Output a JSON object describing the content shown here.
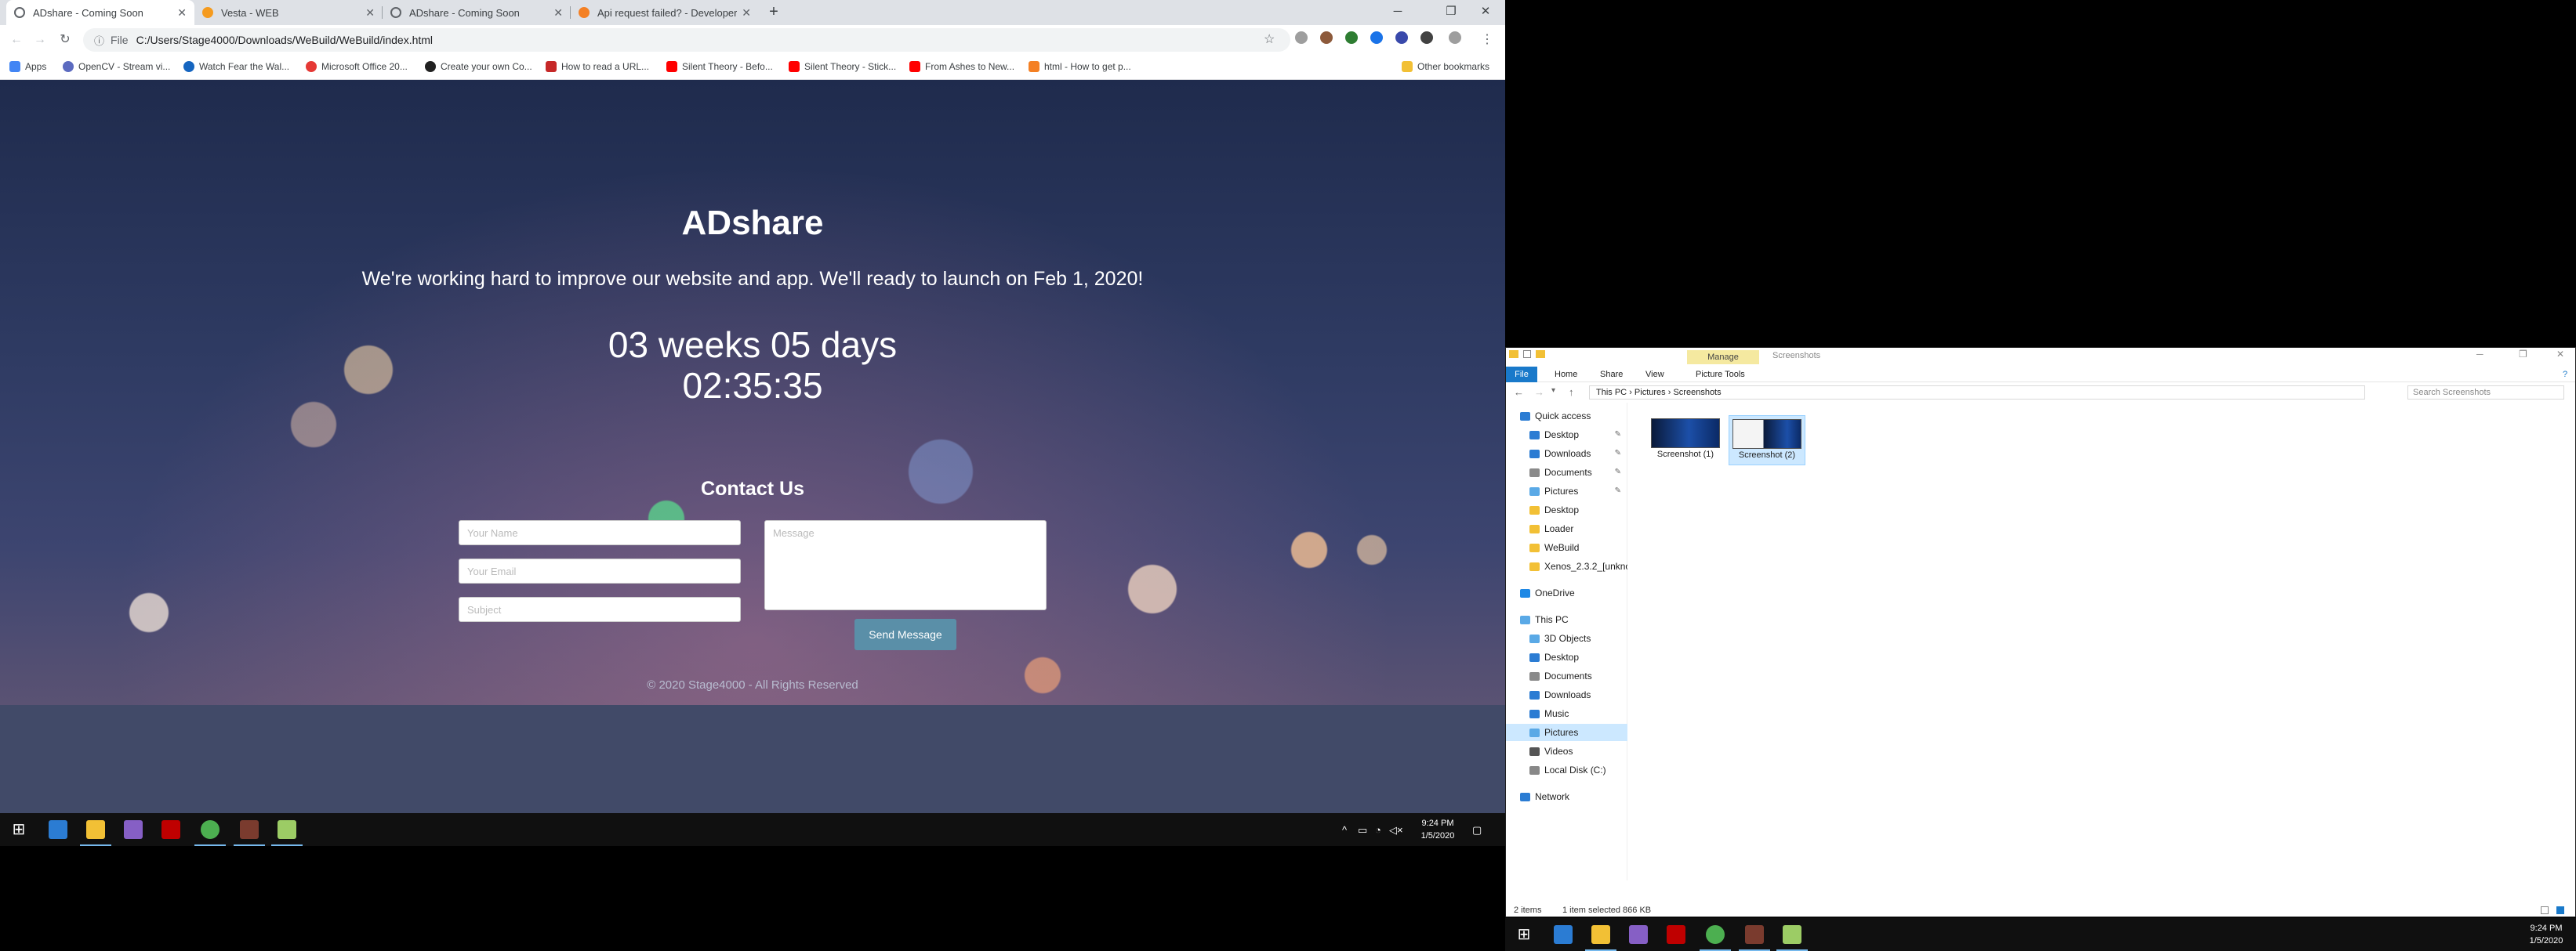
{
  "browser": {
    "tabs": [
      {
        "title": "ADshare - Coming Soon",
        "active": true,
        "favicon_color": "#5f6368"
      },
      {
        "title": "Vesta - WEB",
        "active": false,
        "favicon_color": "#f59b1f"
      },
      {
        "title": "ADshare - Coming Soon",
        "active": false,
        "favicon_color": "#5f6368"
      },
      {
        "title": "Api request failed? - Developers",
        "active": false,
        "favicon_color": "#f48024"
      }
    ],
    "new_tab": "+",
    "window_controls": [
      "─",
      "❐",
      "✕"
    ],
    "nav_glyphs": [
      "←",
      "→",
      "↻"
    ],
    "address_info": "ⓘ",
    "address_scheme": "File",
    "address_url": "C:/Users/Stage4000/Downloads/WeBuild/WeBuild/index.html",
    "star_glyph": "☆",
    "menu_glyph": "⋮",
    "bookmarks": [
      {
        "label": "Apps",
        "color": "#4285f4"
      },
      {
        "label": "OpenCV - Stream vi...",
        "color": "#5c6bc0"
      },
      {
        "label": "Watch Fear the Wal...",
        "color": "#1565c0"
      },
      {
        "label": "Microsoft Office 20...",
        "color": "#e53935"
      },
      {
        "label": "Create your own Co...",
        "color": "#212121"
      },
      {
        "label": "How to read a URL...",
        "color": "#c62828"
      },
      {
        "label": "Silent Theory - Befo...",
        "color": "#ff0000"
      },
      {
        "label": "Silent Theory - Stick...",
        "color": "#ff0000"
      },
      {
        "label": "From Ashes to New...",
        "color": "#ff0000"
      },
      {
        "label": "html - How to get p...",
        "color": "#f48024"
      }
    ],
    "other_bookmarks": "Other bookmarks"
  },
  "site": {
    "title": "ADshare",
    "tagline": "We're working hard to improve our website and app. We'll ready to launch on Feb 1, 2020!",
    "countdown_line1": "03 weeks 05 days",
    "countdown_line2": "02:35:35",
    "contact_heading": "Contact Us",
    "name_placeholder": "Your Name",
    "email_placeholder": "Your Email",
    "subject_placeholder": "Subject",
    "message_placeholder": "Message",
    "send_label": "Send Message",
    "copyright": "© 2020 Stage4000 - All Rights Reserved"
  },
  "taskbar": {
    "start_glyph": "⊞",
    "apps": [
      {
        "name": "edge",
        "color": "#2b7cd3",
        "running": false
      },
      {
        "name": "file-explorer",
        "color": "#f2c035",
        "running": true
      },
      {
        "name": "visual-studio",
        "color": "#865fc5",
        "running": false
      },
      {
        "name": "filezilla",
        "color": "#bf0000",
        "running": false
      },
      {
        "name": "chrome",
        "color": "#4caf50",
        "running": true
      },
      {
        "name": "winrar",
        "color": "#7a3b2e",
        "running": true
      },
      {
        "name": "notepad-plus",
        "color": "#9ccc65",
        "running": true
      }
    ],
    "tray_glyphs": [
      "^",
      "▭",
      "◔",
      "◁×"
    ],
    "notification_glyph": "▢",
    "time": "9:24 PM",
    "date": "1/5/2020"
  },
  "explorer": {
    "title": "Screenshots",
    "manage_label": "Manage",
    "window_controls": [
      "─",
      "❐",
      "✕"
    ],
    "ribbon_tabs": [
      "File",
      "Home",
      "Share",
      "View",
      "Picture Tools"
    ],
    "help_glyph": "?",
    "breadcrumb": [
      "This PC",
      "Pictures",
      "Screenshots"
    ],
    "search_placeholder": "Search Screenshots",
    "nav_items": [
      {
        "label": "Quick access",
        "color": "#2b7cd3",
        "indent": 0
      },
      {
        "label": "Desktop",
        "color": "#2b7cd3",
        "indent": 1,
        "pinned": true
      },
      {
        "label": "Downloads",
        "color": "#2b7cd3",
        "indent": 1,
        "pinned": true
      },
      {
        "label": "Documents",
        "color": "#8a8a8a",
        "indent": 1,
        "pinned": true
      },
      {
        "label": "Pictures",
        "color": "#5aa9e6",
        "indent": 1,
        "pinned": true
      },
      {
        "label": "Desktop",
        "color": "#f2c035",
        "indent": 1
      },
      {
        "label": "Loader",
        "color": "#f2c035",
        "indent": 1
      },
      {
        "label": "WeBuild",
        "color": "#f2c035",
        "indent": 1
      },
      {
        "label": "Xenos_2.3.2_[unkno",
        "color": "#f2c035",
        "indent": 1
      },
      {
        "label": "OneDrive",
        "color": "#1e88e5",
        "indent": 0,
        "gap": true
      },
      {
        "label": "This PC",
        "color": "#5aa9e6",
        "indent": 0,
        "gap": true
      },
      {
        "label": "3D Objects",
        "color": "#5aa9e6",
        "indent": 1
      },
      {
        "label": "Desktop",
        "color": "#2b7cd3",
        "indent": 1
      },
      {
        "label": "Documents",
        "color": "#8a8a8a",
        "indent": 1
      },
      {
        "label": "Downloads",
        "color": "#2b7cd3",
        "indent": 1
      },
      {
        "label": "Music",
        "color": "#2b7cd3",
        "indent": 1
      },
      {
        "label": "Pictures",
        "color": "#5aa9e6",
        "indent": 1,
        "selected": true
      },
      {
        "label": "Videos",
        "color": "#555555",
        "indent": 1
      },
      {
        "label": "Local Disk (C:)",
        "color": "#888888",
        "indent": 1
      },
      {
        "label": "Network",
        "color": "#2b7cd3",
        "indent": 0,
        "gap": true
      }
    ],
    "files": [
      {
        "name": "Screenshot (1)",
        "selected": false
      },
      {
        "name": "Screenshot (2)",
        "selected": true
      }
    ],
    "status_items": "2 items",
    "status_selected": "1 item selected  866 KB"
  }
}
